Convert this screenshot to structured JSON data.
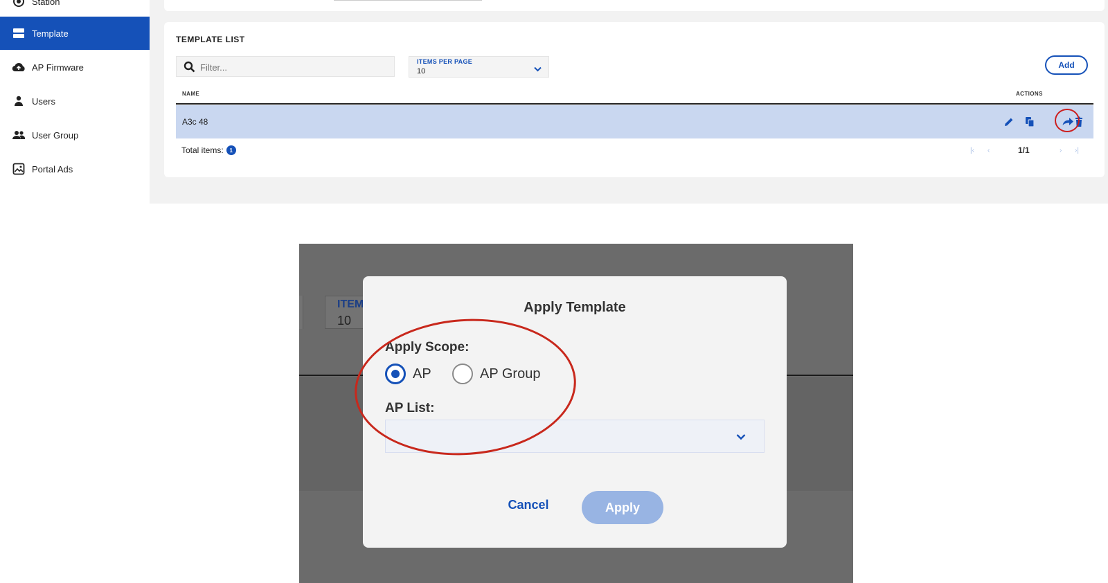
{
  "sidebar": {
    "items": [
      {
        "label": "Station",
        "icon": "station-icon"
      },
      {
        "label": "Template",
        "icon": "template-icon",
        "active": true
      },
      {
        "label": "AP Firmware",
        "icon": "cloud-upload-icon"
      },
      {
        "label": "Users",
        "icon": "user-icon"
      },
      {
        "label": "User Group",
        "icon": "user-group-icon"
      },
      {
        "label": "Portal Ads",
        "icon": "image-icon"
      }
    ]
  },
  "template_list": {
    "title": "TEMPLATE LIST",
    "filter_placeholder": "Filter...",
    "items_per_page_label": "ITEMS PER PAGE",
    "items_per_page_value": "10",
    "add_label": "Add",
    "columns": {
      "name": "NAME",
      "actions": "ACTIONS"
    },
    "rows": [
      {
        "name": "A3c 48",
        "actions": [
          "edit-icon",
          "copy-icon",
          "apply-arrow-icon",
          "delete-icon"
        ]
      }
    ],
    "total_label": "Total items:",
    "total_count": "1",
    "page_indicator": "1/1"
  },
  "modal_background": {
    "items_per_page_label": "ITEM",
    "items_per_page_value": "10"
  },
  "modal": {
    "title": "Apply Template",
    "scope_label": "Apply Scope:",
    "options": [
      {
        "label": "AP",
        "selected": true
      },
      {
        "label": "AP Group",
        "selected": false
      }
    ],
    "ap_list_label": "AP List:",
    "ap_list_value": "",
    "cancel_label": "Cancel",
    "apply_label": "Apply"
  },
  "colors": {
    "accent": "#1551b8",
    "row_highlight": "#c9d7f0",
    "annotation": "#cc1f1f",
    "overlay": "#6b6b6b"
  }
}
